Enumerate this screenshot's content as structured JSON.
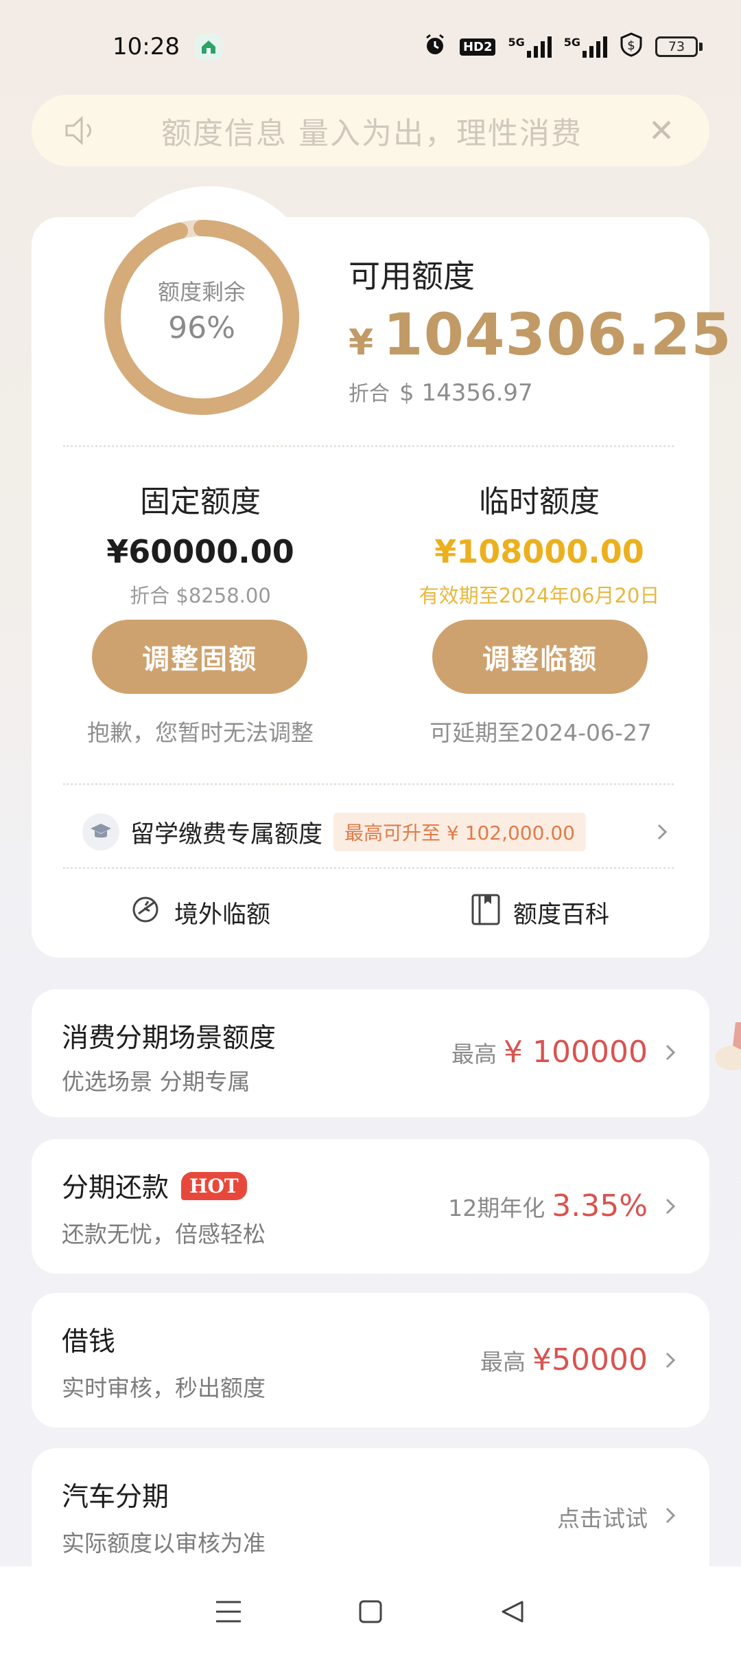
{
  "status_bar": {
    "time": "10:28",
    "network_1": "5G",
    "network_2": "5G",
    "battery": "73",
    "hd_label": "HD2"
  },
  "notice": {
    "text": "额度信息 量入为出，理性消费",
    "close_icon": "close-icon"
  },
  "overview": {
    "ring_label": "额度剩余",
    "ring_percent": "96%",
    "ring_fraction": 0.96,
    "available_title": "可用额度",
    "currency": "¥",
    "available_amount": "104306.25",
    "usd_prefix": "折合",
    "usd_amount": "$ 14356.97"
  },
  "fixed": {
    "title": "固定额度",
    "amount": "¥60000.00",
    "sub": "折合 $8258.00",
    "button": "调整固额",
    "note": "抱歉，您暂时无法调整"
  },
  "temporary": {
    "title": "临时额度",
    "amount": "¥108000.00",
    "sub": "有效期至2024年06月20日",
    "button": "调整临额",
    "note": "可延期至2024-06-27"
  },
  "study": {
    "title": "留学缴费专属额度",
    "tag": "最高可升至 ¥ 102,000.00"
  },
  "tools": {
    "overseas": "境外临额",
    "encyclopedia": "额度百科"
  },
  "cards": [
    {
      "title": "消费分期场景额度",
      "sub": "优选场景 分期专属",
      "pre": "最高",
      "value": "¥ 100000"
    },
    {
      "title": "分期还款",
      "hot": "HOT",
      "sub": "还款无忧，倍感轻松",
      "pre": "12期年化",
      "value": "3.35%"
    },
    {
      "title": "借钱",
      "sub": "实时审核，秒出额度",
      "pre": "最高",
      "value": "¥50000"
    },
    {
      "title": "汽车分期",
      "sub": "实际额度以审核为准",
      "pre": "点击试试",
      "value": ""
    }
  ],
  "colors": {
    "gold": "#c19a66",
    "button": "#cea26e",
    "temp_gold": "#ecb01e",
    "red": "#d9534f"
  }
}
